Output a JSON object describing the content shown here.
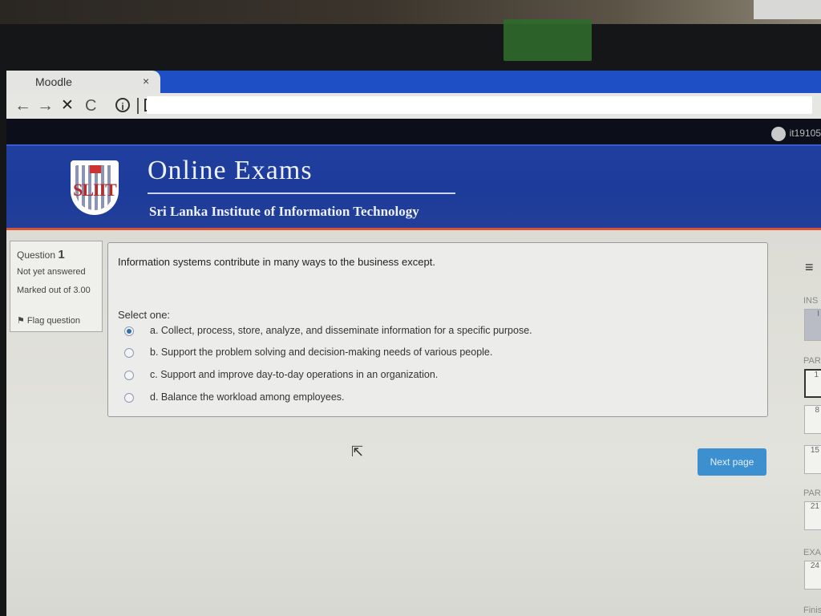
{
  "browser": {
    "tab_title": "Moodle",
    "tab_close": "×",
    "nav": {
      "back": "←",
      "forward": "→",
      "stop": "✕",
      "reload": "C"
    },
    "info_glyph": "i"
  },
  "header": {
    "user": "it19105",
    "site_title": "Online Exams",
    "site_subtitle": "Sri Lanka Institute of Information Technology",
    "logo_text": "SLIIT"
  },
  "question_info": {
    "label": "Question",
    "number": "1",
    "state": "Not yet answered",
    "grade": "Marked out of 3.00",
    "flag": "Flag question"
  },
  "question": {
    "text": "Information systems contribute in many ways to the business except.",
    "prompt": "Select one:",
    "options": [
      {
        "label": "a. Collect, process, store, analyze, and disseminate information for a specific purpose.",
        "selected": true
      },
      {
        "label": "b. Support the problem solving and decision-making needs of various people.",
        "selected": false
      },
      {
        "label": "c. Support and improve day-to-day operations in an organization.",
        "selected": false
      },
      {
        "label": "d. Balance the workload among employees.",
        "selected": false
      }
    ]
  },
  "next_button": "Next page",
  "quiz_nav": {
    "menu_icon": "≡",
    "sections": [
      "INS",
      "PAR",
      "PAR",
      "EXA"
    ],
    "items": [
      "I",
      "1",
      "8",
      "15",
      "21",
      "24"
    ],
    "footer": "Finish"
  },
  "colors": {
    "banner": "#1c3b9a",
    "tabbar": "#1f4fc4",
    "accent": "#3d90cf"
  }
}
